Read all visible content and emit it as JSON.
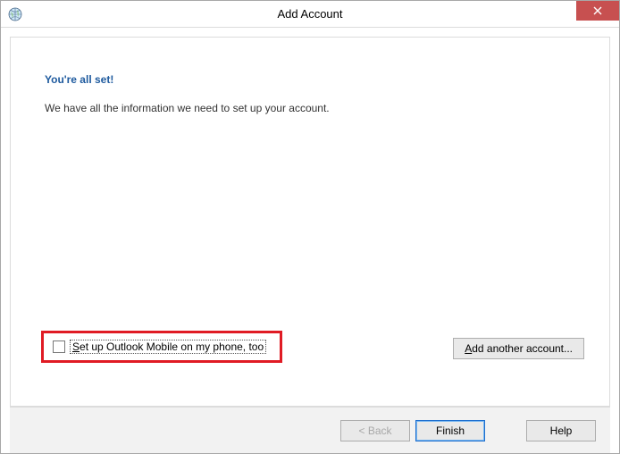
{
  "window": {
    "title": "Add Account"
  },
  "page": {
    "heading": "You're all set!",
    "body": "We have all the information we need to set up your account."
  },
  "checkbox": {
    "mobile_prefix": "S",
    "mobile_rest": "et up Outlook Mobile on my phone, too",
    "checked": false
  },
  "buttons": {
    "add_another_prefix": "A",
    "add_another_rest": "dd another account...",
    "back": "< Back",
    "finish": "Finish",
    "help": "Help"
  }
}
